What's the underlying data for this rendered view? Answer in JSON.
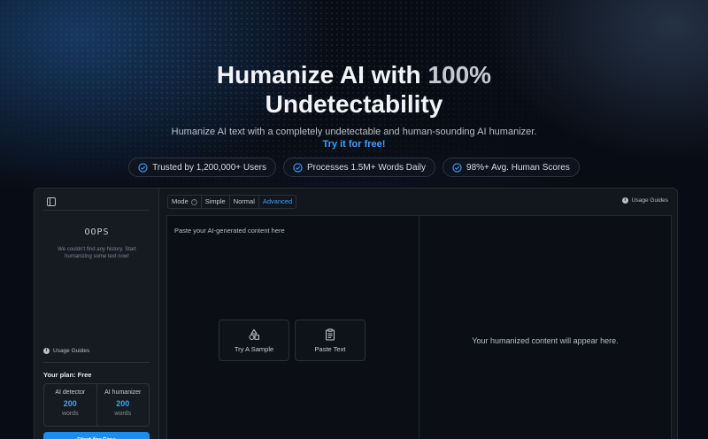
{
  "hero": {
    "title_line1_a": "Humanize AI with ",
    "title_line1_b": "100%",
    "title_line2": "Undetectability",
    "subtitle": "Humanize AI text with a completely undetectable and human-sounding AI humanizer.",
    "try_link": "Try it for free!",
    "badges": [
      {
        "icon": "check-circle-icon",
        "label": "Trusted by 1,200,000+ Users"
      },
      {
        "icon": "check-circle-icon",
        "label": "Processes 1.5M+ Words Daily"
      },
      {
        "icon": "check-circle-icon",
        "label": "98%+ Avg. Human Scores"
      }
    ]
  },
  "sidebar": {
    "empty_title": "OOPS",
    "empty_message": "We couldn't find any history. Start humanizing some text now!",
    "usage_guides": "Usage Guides",
    "plan_label": "Your plan: Free",
    "plan": [
      {
        "label": "AI detector",
        "value": "200",
        "unit": "words"
      },
      {
        "label": "AI humanizer",
        "value": "200",
        "unit": "words"
      }
    ],
    "start_button": "Start for Free"
  },
  "toolbar": {
    "mode_label": "Mode",
    "options": [
      "Simple",
      "Normal",
      "Advanced"
    ],
    "selected": "Advanced",
    "usage_guides": "Usage Guides"
  },
  "editor": {
    "input_placeholder": "Paste your AI-generated content here",
    "try_sample": "Try A Sample",
    "paste_text": "Paste Text",
    "output_placeholder": "Your humanized content will appear here."
  },
  "colors": {
    "accent": "#3ea0ff",
    "button": "#1b8cf0",
    "background": "#080c14"
  }
}
